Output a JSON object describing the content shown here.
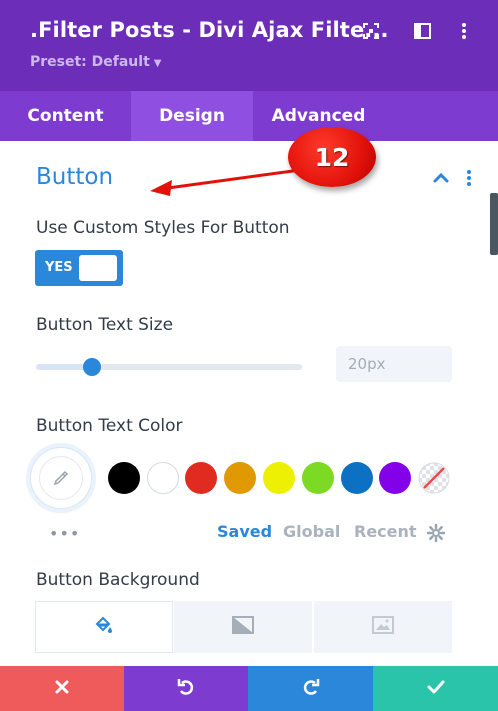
{
  "header": {
    "title": ".Filter Posts - Divi Ajax Filte...",
    "preset": "Preset: Default",
    "icons": [
      "focus-icon",
      "sidebar-layout-icon",
      "more-vertical-icon"
    ]
  },
  "tabs": [
    {
      "label": "Content",
      "active": false
    },
    {
      "label": "Design",
      "active": true
    },
    {
      "label": "Advanced",
      "active": false
    }
  ],
  "section": {
    "title": "Button"
  },
  "custom_styles": {
    "label": "Use Custom Styles For Button",
    "toggle_text": "YES",
    "enabled": true
  },
  "text_size": {
    "label": "Button Text Size",
    "value": "20px",
    "slider_fraction": 0.21
  },
  "text_color": {
    "label": "Button Text Color",
    "swatches": [
      "#000000",
      "#ffffff",
      "#e02b20",
      "#e09900",
      "#edf000",
      "#7cda24",
      "#0c71c3",
      "#8300e9",
      "transparent"
    ],
    "palette_tabs": [
      {
        "label": "Saved",
        "active": true
      },
      {
        "label": "Global",
        "active": false
      },
      {
        "label": "Recent",
        "active": false
      }
    ],
    "more": "•••"
  },
  "background": {
    "label": "Button Background",
    "tabs": [
      "paint-bucket-icon",
      "gradient-icon",
      "image-icon"
    ]
  },
  "footer": {
    "buttons": [
      {
        "name": "discard",
        "color": "#ef5a5a",
        "icon": "close-icon"
      },
      {
        "name": "undo",
        "color": "#7e3bd0",
        "icon": "undo-icon"
      },
      {
        "name": "redo",
        "color": "#2b87da",
        "icon": "redo-icon"
      },
      {
        "name": "save",
        "color": "#29c4a9",
        "icon": "check-icon"
      }
    ]
  },
  "annotation": {
    "number": "12",
    "color": "#e2120a"
  },
  "colors": {
    "header_bg": "#6c2eb9",
    "tabs_bg": "#7e3bd0",
    "accent": "#2b87da"
  }
}
